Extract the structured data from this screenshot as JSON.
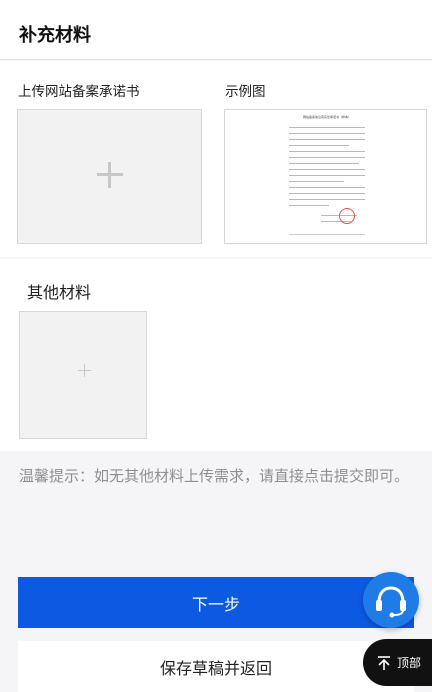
{
  "header": {
    "title": "补充材料"
  },
  "website_filing": {
    "upload_label": "上传网站备案承诺书",
    "sample_label": "示例图",
    "sample_doc_title": "网站备案信息真实性承诺书（样本）"
  },
  "other_materials": {
    "label": "其他材料"
  },
  "hint": {
    "text": "温馨提示：如无其他材料上传需求，请直接点击提交即可。"
  },
  "actions": {
    "next_label": "下一步",
    "save_label": "保存草稿并返回"
  },
  "floating": {
    "customer_service_icon": "headset-icon",
    "back_to_top_label": "顶部"
  },
  "colors": {
    "primary": "#0c5ae1",
    "cs_button": "#1f7be6",
    "top_button": "#111111"
  }
}
